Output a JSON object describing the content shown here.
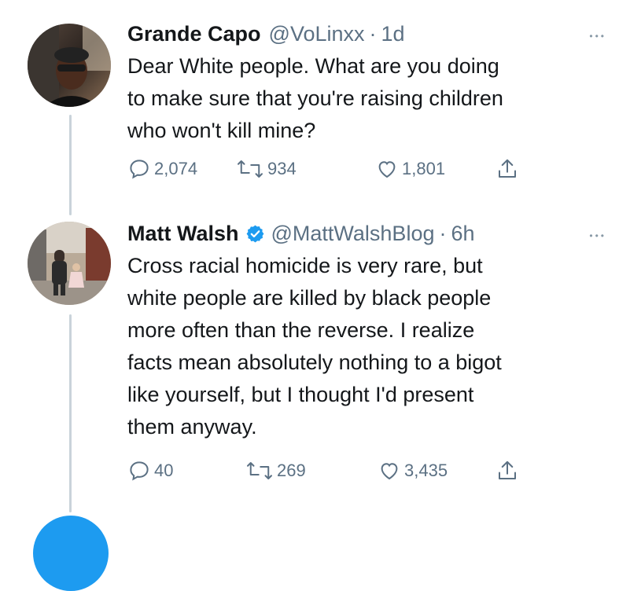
{
  "tweets": [
    {
      "name": "Grande Capo",
      "handle": "@VoLinxx",
      "separator": "·",
      "time": "1d",
      "verified": false,
      "lines": [
        "Dear White people. What are you doing",
        "to make sure that you're raising children",
        "who won't kill mine?"
      ],
      "replies": "2,074",
      "retweets": "934",
      "likes": "1,801",
      "more": "•••"
    },
    {
      "name": "Matt Walsh",
      "handle": "@MattWalshBlog",
      "separator": "·",
      "time": "6h",
      "verified": true,
      "lines": [
        "Cross racial homicide is very rare, but",
        "white people are killed by black people",
        "more often than the reverse. I realize",
        "facts mean absolutely nothing to a bigot",
        "like yourself, but I thought I'd present",
        "them anyway."
      ],
      "replies": "40",
      "retweets": "269",
      "likes": "3,435",
      "more": "•••"
    }
  ],
  "colors": {
    "text": "#14171a",
    "secondary": "#5b7083",
    "verified": "#1d9bf0",
    "thread_line": "#c9d3da"
  }
}
